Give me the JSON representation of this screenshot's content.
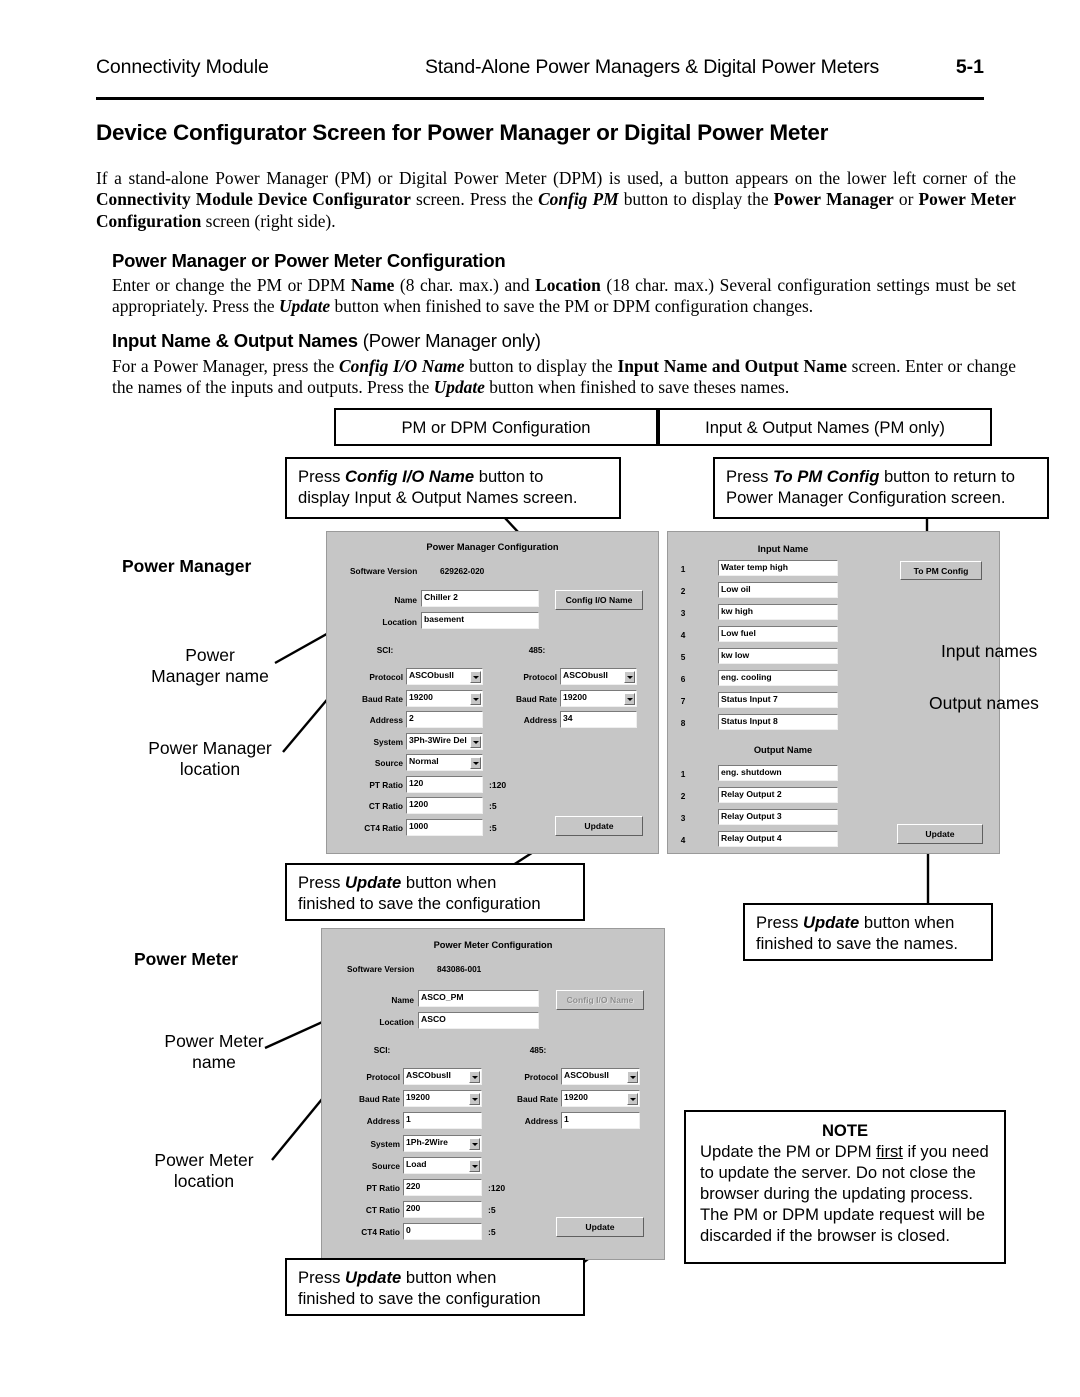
{
  "header": {
    "left": "Connectivity Module",
    "middle": "Stand-Alone Power Managers & Digital Power Meters",
    "page": "5-1"
  },
  "title": "Device Configurator Screen for Power Manager or Digital Power Meter",
  "intro_paragraph": {
    "line1_a": "If a stand-alone Power Manager (PM) or Digital Power Meter (DPM) is used, a button appears on the lower left",
    "line2_a": "corner of the ",
    "line2_b": "Connectivity Module Device Configurator",
    "line2_c": " screen.  Press the ",
    "line2_d": "Config PM",
    "line2_e": " button to display the ",
    "line2_f": "Power",
    "line3_a": "Manager",
    "line3_b": " or ",
    "line3_c": "Power Meter Configuration",
    "line3_d": " screen (right side)."
  },
  "section1": {
    "heading": "Power Manager or Power Meter Configuration",
    "body_a": "Enter or change the PM or DPM ",
    "body_b": "Name",
    "body_c": " (8 char. max.) and ",
    "body_d": "Location",
    "body_e": " (18 char. max.)  Several configuration settings must be set appropriately.  Press the ",
    "body_f": "Update",
    "body_g": " button when finished to save the PM or DPM configuration changes."
  },
  "section2": {
    "heading_bold": "Input Name & Output Names",
    "heading_reg": " (Power Manager only)",
    "body_a": "For a Power Manager, press the ",
    "body_b": "Config I/O Name",
    "body_c": " button to display the ",
    "body_d": "Input Name and Output Name",
    "body_e": " screen. Enter or change the names of the inputs and outputs. Press the ",
    "body_f": "Update",
    "body_g": " button when finished to save theses names."
  },
  "tabs": {
    "left": "PM or DPM Configuration",
    "right": "Input & Output Names (PM only)"
  },
  "callouts": {
    "config_io": {
      "a": "Press ",
      "b": "Config I/O Name",
      "c": " button to",
      "d": "display Input & Output Names screen."
    },
    "to_pm_config": {
      "a": "Press ",
      "b": "To PM Config",
      "c": " button to return to",
      "d": "Power Manager Configuration screen."
    },
    "update_pm_cfg": {
      "a": "Press ",
      "b": "Update",
      "c": " button when",
      "d": "finished to save the configuration"
    },
    "update_names": {
      "a": "Press ",
      "b": "Update",
      "c": " button when",
      "d": "finished to save the names."
    },
    "update_meter_cfg": {
      "a": "Press ",
      "b": "Update",
      "c": " button when",
      "d": "finished to save the configuration"
    }
  },
  "annotations": {
    "power_manager": "Power Manager",
    "pm_name": "Power\nManager name",
    "pm_location": "Power Manager\nlocation",
    "input_names": "Input names",
    "output_names": "Output names",
    "power_meter": "Power Meter",
    "meter_name": "Power Meter\nname",
    "meter_location": "Power Meter\nlocation"
  },
  "note": {
    "title": "NOTE",
    "line1_a": "Update the PM or DPM ",
    "line1_b": "first",
    "line1_c": " if you",
    "rest": "need to update the server. Do not close the browser during the updating process. The PM or DPM update request will be discarded if the browser is closed."
  },
  "pm_config": {
    "title": "Power Manager Configuration",
    "software_version_label": "Software Version",
    "software_version_value": "629262-020",
    "name_label": "Name",
    "name_value": "Chiller 2",
    "location_label": "Location",
    "location_value": "basement",
    "config_io_button": "Config I/O Name",
    "sci_label": "SCI:",
    "r485_label": "485:",
    "protocol_label": "Protocol",
    "baud_label": "Baud Rate",
    "address_label": "Address",
    "sci_protocol": "ASCObusII",
    "sci_baud": "19200",
    "sci_address": "2",
    "r485_protocol": "ASCObusII",
    "r485_baud": "19200",
    "r485_address": "34",
    "system_label": "System",
    "system_value": "3Ph-3Wire Del",
    "source_label": "Source",
    "source_value": "Normal",
    "pt_label": "PT Ratio",
    "pt_value": "120",
    "pt_suffix": ":120",
    "ct_label": "CT Ratio",
    "ct_value": "1200",
    "ct_suffix": ":5",
    "ct4_label": "CT4 Ratio",
    "ct4_value": "1000",
    "ct4_suffix": ":5",
    "update_button": "Update"
  },
  "io_names": {
    "input_title": "Input Name",
    "to_pm_button": "To PM Config",
    "inputs": [
      {
        "n": "1",
        "v": "Water temp high"
      },
      {
        "n": "2",
        "v": "Low oil"
      },
      {
        "n": "3",
        "v": "kw high"
      },
      {
        "n": "4",
        "v": "Low fuel"
      },
      {
        "n": "5",
        "v": "kw low"
      },
      {
        "n": "6",
        "v": "eng. cooling"
      },
      {
        "n": "7",
        "v": "Status Input 7"
      },
      {
        "n": "8",
        "v": "Status Input 8"
      }
    ],
    "output_title": "Output Name",
    "outputs": [
      {
        "n": "1",
        "v": "eng. shutdown"
      },
      {
        "n": "2",
        "v": "Relay Output 2"
      },
      {
        "n": "3",
        "v": "Relay Output 3"
      },
      {
        "n": "4",
        "v": "Relay Output 4"
      }
    ],
    "update_button": "Update"
  },
  "meter_config": {
    "title": "Power Meter Configuration",
    "software_version_label": "Software Version",
    "software_version_value": "843086-001",
    "name_label": "Name",
    "name_value": "ASCO_PM",
    "location_label": "Location",
    "location_value": "ASCO",
    "config_io_button": "Config I/O Name",
    "sci_label": "SCI:",
    "r485_label": "485:",
    "protocol_label": "Protocol",
    "baud_label": "Baud Rate",
    "address_label": "Address",
    "sci_protocol": "ASCObusII",
    "sci_baud": "19200",
    "sci_address": "1",
    "r485_protocol": "ASCObusII",
    "r485_baud": "19200",
    "r485_address": "1",
    "system_label": "System",
    "system_value": "1Ph-2Wire",
    "source_label": "Source",
    "source_value": "Load",
    "pt_label": "PT Ratio",
    "pt_value": "220",
    "pt_suffix": ":120",
    "ct_label": "CT Ratio",
    "ct_value": "200",
    "ct_suffix": ":5",
    "ct4_label": "CT4 Ratio",
    "ct4_value": "0",
    "ct4_suffix": ":5",
    "update_button": "Update"
  }
}
